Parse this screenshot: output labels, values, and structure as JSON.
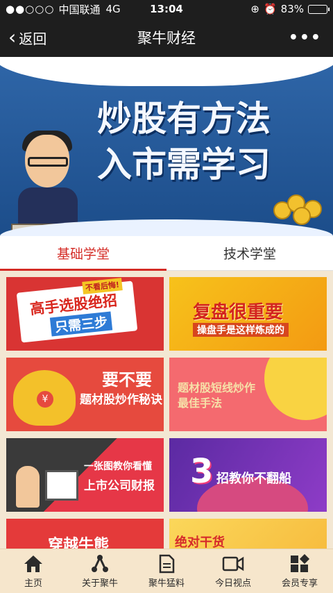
{
  "status_bar": {
    "signal_dots": "●●○○○",
    "carrier": "中国联通",
    "network": "4G",
    "time": "13:04",
    "battery_percent": "83%",
    "battery_level": 0.83
  },
  "nav": {
    "back_label": "返回",
    "title": "聚牛财经",
    "more_label": "•••"
  },
  "banner": {
    "line1": "炒股有方法",
    "line2": "入市需学习"
  },
  "tabs": [
    {
      "label": "基础学堂",
      "active": true
    },
    {
      "label": "技术学堂",
      "active": false
    }
  ],
  "cards": {
    "c1": {
      "tag": "不看后悔!",
      "line1": "高手选股绝招",
      "line2": "只需三步"
    },
    "c2": {
      "line1": "复盘很重要",
      "line2": "操盘手是这样炼成的"
    },
    "c3": {
      "yen": "¥",
      "line1": "要不要",
      "line2": "题材股炒作秘诀"
    },
    "c4": {
      "line1": "题材股短线炒作",
      "line2": "最佳手法"
    },
    "c5": {
      "line1": "一张图教你看懂",
      "line2": "上市公司财报"
    },
    "c6": {
      "number": "3",
      "line1": "招教你不翻船"
    },
    "c7": {
      "line1": "穿越牛熊"
    },
    "c8": {
      "line1": "绝对干货"
    }
  },
  "tabbar": [
    {
      "label": "主页",
      "icon": "home-icon"
    },
    {
      "label": "关于聚牛",
      "icon": "share-nodes-icon"
    },
    {
      "label": "聚牛猛料",
      "icon": "document-icon"
    },
    {
      "label": "今日视点",
      "icon": "video-icon"
    },
    {
      "label": "会员专享",
      "icon": "grid-diamond-icon"
    }
  ],
  "colors": {
    "accent": "#d42b25",
    "nav_bg": "#1e1e1e",
    "page_bg": "#f3e7d3",
    "tabbar_bg": "#f6e6cc"
  }
}
